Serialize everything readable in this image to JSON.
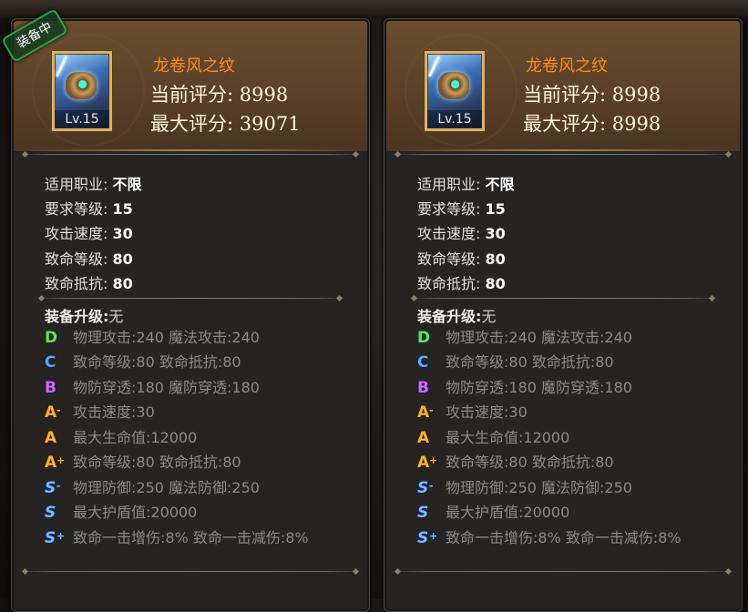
{
  "badge": "装备中",
  "panels": [
    {
      "title": "龙卷风之纹",
      "level": "Lv.15",
      "current_score": "当前评分: 8998",
      "max_score": "最大评分: 39071",
      "stats": [
        {
          "label": "适用职业:",
          "value": "不限"
        },
        {
          "label": "要求等级:",
          "value": "15"
        },
        {
          "label": "攻击速度:",
          "value": "30"
        },
        {
          "label": "致命等级:",
          "value": "80"
        },
        {
          "label": "致命抵抗:",
          "value": "80"
        }
      ],
      "upgrade_label": "装备升级:",
      "upgrade_value": "无",
      "grades": [
        {
          "grade": "D",
          "mod": "",
          "text": "物理攻击:240  魔法攻击:240"
        },
        {
          "grade": "C",
          "mod": "",
          "text": "致命等级:80  致命抵抗:80"
        },
        {
          "grade": "B",
          "mod": "",
          "text": "物防穿透:180  魔防穿透:180"
        },
        {
          "grade": "A",
          "mod": "-",
          "text": "攻击速度:30"
        },
        {
          "grade": "A",
          "mod": "",
          "text": "最大生命值:12000"
        },
        {
          "grade": "A",
          "mod": "+",
          "text": "致命等级:80  致命抵抗:80"
        },
        {
          "grade": "S",
          "mod": "-",
          "text": "物理防御:250  魔法防御:250"
        },
        {
          "grade": "S",
          "mod": "",
          "text": "最大护盾值:20000"
        },
        {
          "grade": "S",
          "mod": "+",
          "text": "致命一击增伤:8%  致命一击减伤:8%"
        }
      ]
    },
    {
      "title": "龙卷风之纹",
      "level": "Lv.15",
      "current_score": "当前评分: 8998",
      "max_score": "最大评分: 8998",
      "stats": [
        {
          "label": "适用职业:",
          "value": "不限"
        },
        {
          "label": "要求等级:",
          "value": "15"
        },
        {
          "label": "攻击速度:",
          "value": "30"
        },
        {
          "label": "致命等级:",
          "value": "80"
        },
        {
          "label": "致命抵抗:",
          "value": "80"
        }
      ],
      "upgrade_label": "装备升级:",
      "upgrade_value": "无",
      "grades": [
        {
          "grade": "D",
          "mod": "",
          "text": "物理攻击:240  魔法攻击:240"
        },
        {
          "grade": "C",
          "mod": "",
          "text": "致命等级:80  致命抵抗:80"
        },
        {
          "grade": "B",
          "mod": "",
          "text": "物防穿透:180  魔防穿透:180"
        },
        {
          "grade": "A",
          "mod": "-",
          "text": "攻击速度:30"
        },
        {
          "grade": "A",
          "mod": "",
          "text": "最大生命值:12000"
        },
        {
          "grade": "A",
          "mod": "+",
          "text": "致命等级:80  致命抵抗:80"
        },
        {
          "grade": "S",
          "mod": "-",
          "text": "物理防御:250  魔法防御:250"
        },
        {
          "grade": "S",
          "mod": "",
          "text": "最大护盾值:20000"
        },
        {
          "grade": "S",
          "mod": "+",
          "text": "致命一击增伤:8%  致命一击减伤:8%"
        }
      ]
    }
  ]
}
